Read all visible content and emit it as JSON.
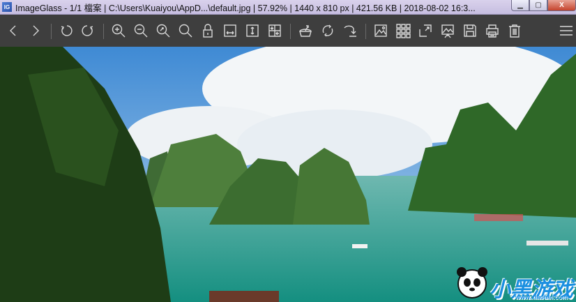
{
  "titlebar": {
    "app_icon_text": "IG",
    "title": "ImageGlass - 1/1 檔案 | C:\\Users\\Kuaiyou\\AppD...\\default.jpg | 57.92% | 1440 x 810 px | 421.56 KB | 2018-08-02 16:3...",
    "minimize": "▁",
    "maximize": "▢",
    "close": "X"
  },
  "toolbar": {
    "buttons": [
      "previous-image",
      "next-image",
      "rotate-left",
      "rotate-right",
      "zoom-in",
      "zoom-out",
      "scale-to-fit",
      "actual-size",
      "lock-zoom",
      "scale-to-width",
      "scale-to-height",
      "auto-zoom",
      "open-with",
      "refresh",
      "goto-image",
      "thumbnail-bar",
      "checkerboard-background",
      "fullscreen",
      "slideshow",
      "save-as",
      "print",
      "delete",
      "menu"
    ]
  },
  "watermark": {
    "text": "小黑游戏",
    "url": "www.xiaohei.com"
  }
}
